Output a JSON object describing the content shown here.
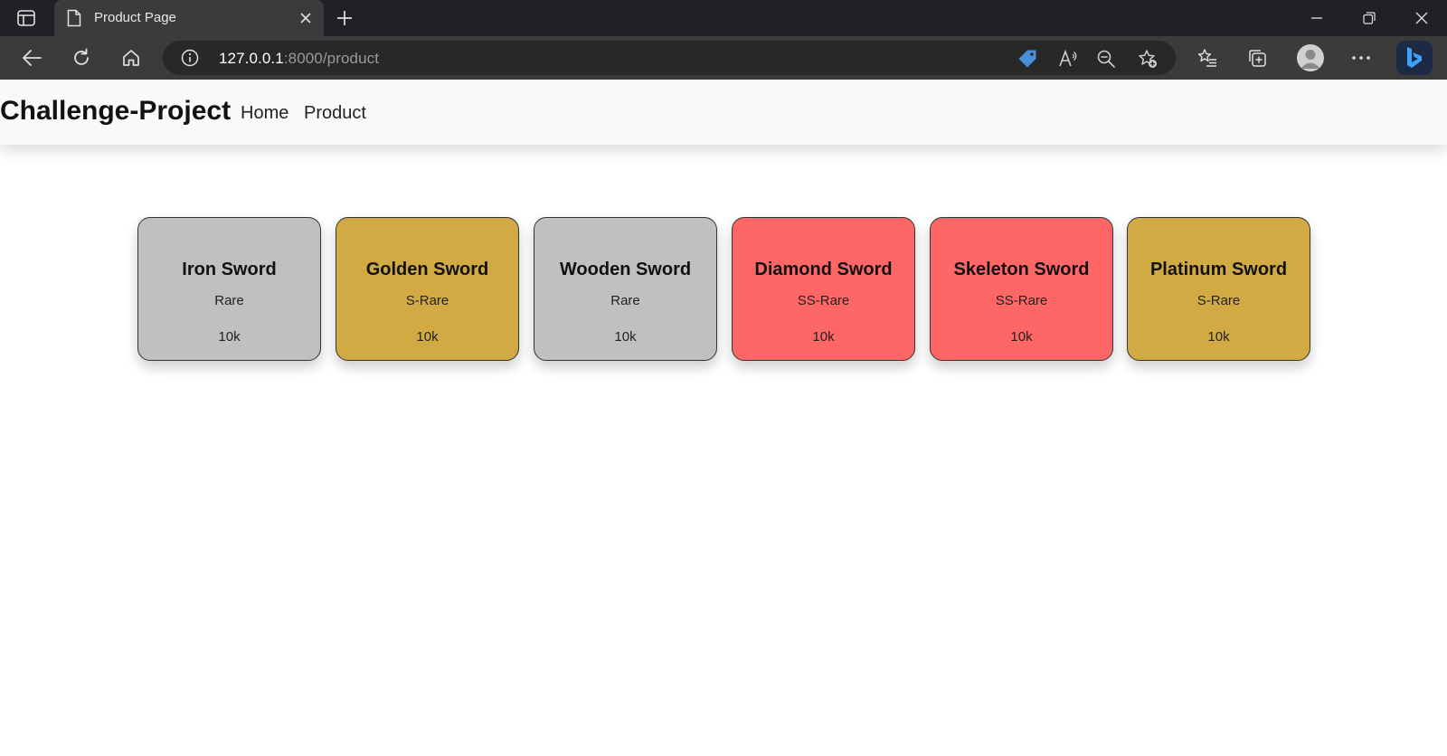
{
  "browser": {
    "tab_title": "Product Page",
    "url_host": "127.0.0.1",
    "url_path": ":8000/product"
  },
  "navbar": {
    "brand": "Challenge-Project",
    "links": [
      "Home",
      "Product"
    ]
  },
  "products": [
    {
      "name": "Iron Sword",
      "rarity": "Rare",
      "price": "10k",
      "color": "#c0c0c0"
    },
    {
      "name": "Golden Sword",
      "rarity": "S-Rare",
      "price": "10k",
      "color": "#d1aa43"
    },
    {
      "name": "Wooden Sword",
      "rarity": "Rare",
      "price": "10k",
      "color": "#c0c0c0"
    },
    {
      "name": "Diamond Sword",
      "rarity": "SS-Rare",
      "price": "10k",
      "color": "#ff6666"
    },
    {
      "name": "Skeleton Sword",
      "rarity": "SS-Rare",
      "price": "10k",
      "color": "#ff6666"
    },
    {
      "name": "Platinum Sword",
      "rarity": "S-Rare",
      "price": "10k",
      "color": "#d1aa43"
    }
  ]
}
